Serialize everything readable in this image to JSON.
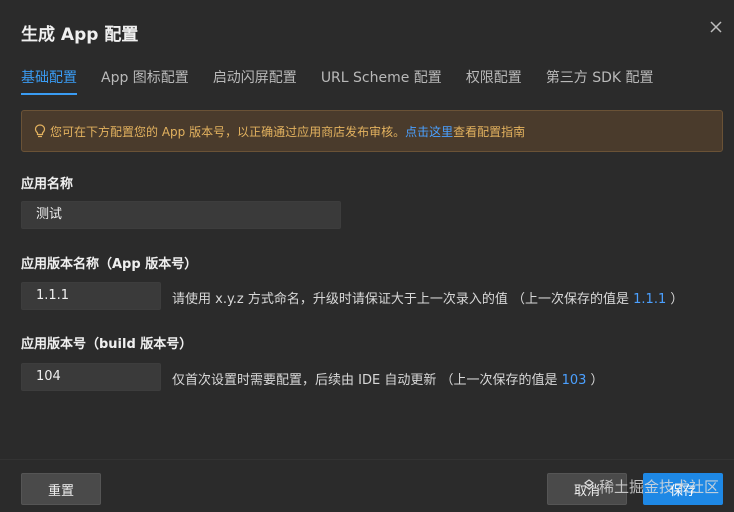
{
  "dialog": {
    "title": "生成 App 配置",
    "close_icon": "close-icon"
  },
  "tabs": [
    {
      "label": "基础配置",
      "active": true
    },
    {
      "label": "App 图标配置"
    },
    {
      "label": "启动闪屏配置"
    },
    {
      "label": "URL Scheme 配置"
    },
    {
      "label": "权限配置"
    },
    {
      "label": "第三方 SDK 配置"
    }
  ],
  "notice": {
    "icon": "lightbulb-icon",
    "text": "您可在下方配置您的 App 版本号，以正确通过应用商店发布审核。",
    "link": "点击这里",
    "suffix": "查看配置指南",
    "color": "#e3b25f",
    "link_color": "#4ba0ff"
  },
  "fields": {
    "app_name": {
      "label": "应用名称",
      "value": "测试"
    },
    "version_name": {
      "label": "应用版本名称（App 版本号）",
      "value": "1.1.1",
      "hint": "请使用 x.y.z 方式命名，升级时请保证大于上一次录入的值 （上一次保存的值是 ",
      "last_value": "1.1.1",
      "hint_end": " ）"
    },
    "version_code": {
      "label": "应用版本号（build 版本号）",
      "value": "104",
      "hint": "仅首次设置时需要配置，后续由 IDE 自动更新 （上一次保存的值是 ",
      "last_value": "103",
      "hint_end": " ）"
    }
  },
  "footer": {
    "reset": "重置",
    "cancel": "取消",
    "save": "保存",
    "accent": "#1e88e5"
  },
  "watermark": "稀土掘金技术社区"
}
